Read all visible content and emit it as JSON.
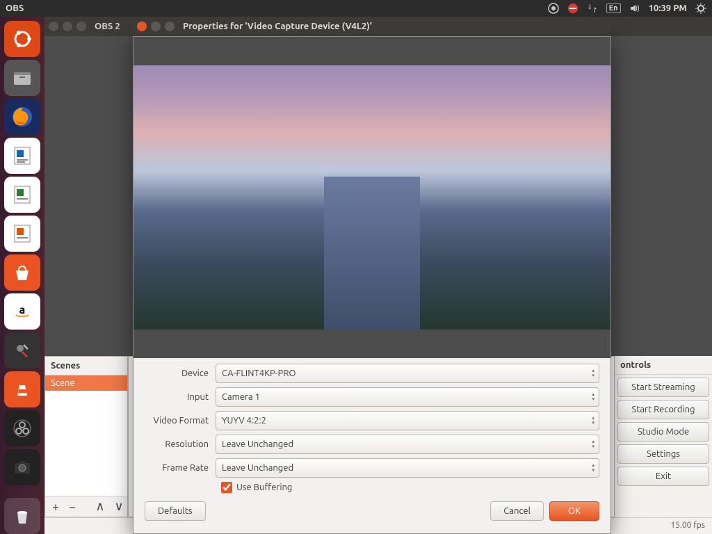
{
  "topbar": {
    "app_title": "OBS",
    "lang_indicator": "En",
    "clock": "10:39 PM"
  },
  "obs_window": {
    "title": "OBS 2",
    "scenes_header": "Scenes",
    "controls_header": "ontrols",
    "scene_name": "Scene",
    "buttons": {
      "start_streaming": "Start Streaming",
      "start_recording": "Start Recording",
      "studio_mode": "Studio Mode",
      "settings": "Settings",
      "exit": "Exit"
    },
    "status_fps": "15.00 fps"
  },
  "modal": {
    "title": "Properties for 'Video Capture Device (V4L2)'",
    "labels": {
      "device": "Device",
      "input": "Input",
      "video_format": "Video Format",
      "resolution": "Resolution",
      "frame_rate": "Frame Rate",
      "use_buffering": "Use Buffering"
    },
    "values": {
      "device": "CA-FLINT4KP-PRO",
      "input": "Camera 1",
      "video_format": "YUYV 4:2:2",
      "resolution": "Leave Unchanged",
      "frame_rate": "Leave Unchanged",
      "use_buffering": true
    },
    "buttons": {
      "defaults": "Defaults",
      "cancel": "Cancel",
      "ok": "OK"
    }
  },
  "launcher_icons": [
    "ubuntu",
    "files",
    "firefox",
    "writer",
    "calc",
    "impress",
    "software",
    "amazon",
    "settings",
    "vlc",
    "obs",
    "camera",
    "trash"
  ]
}
